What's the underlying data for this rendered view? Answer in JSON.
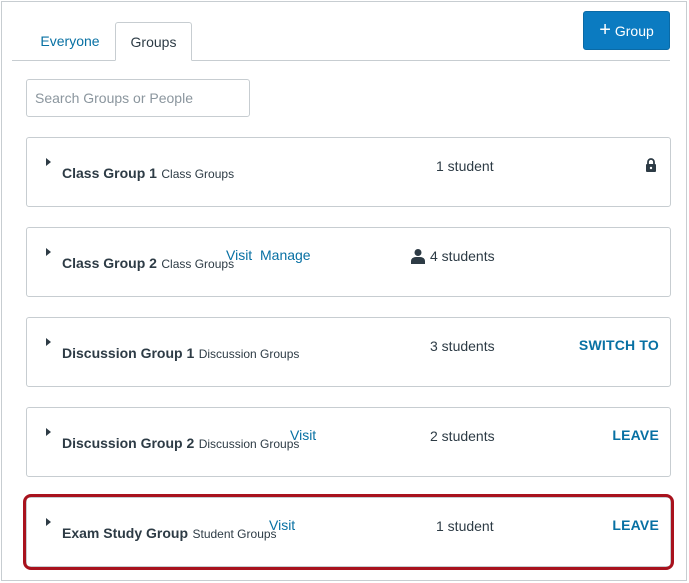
{
  "tabs": [
    {
      "label": "Everyone"
    },
    {
      "label": "Groups"
    }
  ],
  "add_group_button": {
    "label": "Group",
    "icon": "plus-icon"
  },
  "search": {
    "placeholder": "Search Groups or People",
    "value": ""
  },
  "groups": [
    {
      "name": "Class Group 1",
      "category": "Class Groups",
      "count": "1 student",
      "icon": "lock-icon"
    },
    {
      "name": "Class Group 2",
      "category": "Class Groups",
      "links": [
        "Visit",
        "Manage"
      ],
      "count": "4 students",
      "icon": "user-icon"
    },
    {
      "name": "Discussion Group 1",
      "category": "Discussion Groups",
      "count": "3 students",
      "action": "SWITCH TO"
    },
    {
      "name": "Discussion Group 2",
      "category": "Discussion Groups",
      "links": [
        "Visit"
      ],
      "count": "2 students",
      "action": "LEAVE"
    },
    {
      "name": "Exam Study Group",
      "category": "Student Groups",
      "links": [
        "Visit"
      ],
      "count": "1 student",
      "action": "LEAVE"
    }
  ],
  "colors": {
    "accent": "#0770a3",
    "button": "#0b7bc1",
    "highlight": "#a8121d"
  }
}
